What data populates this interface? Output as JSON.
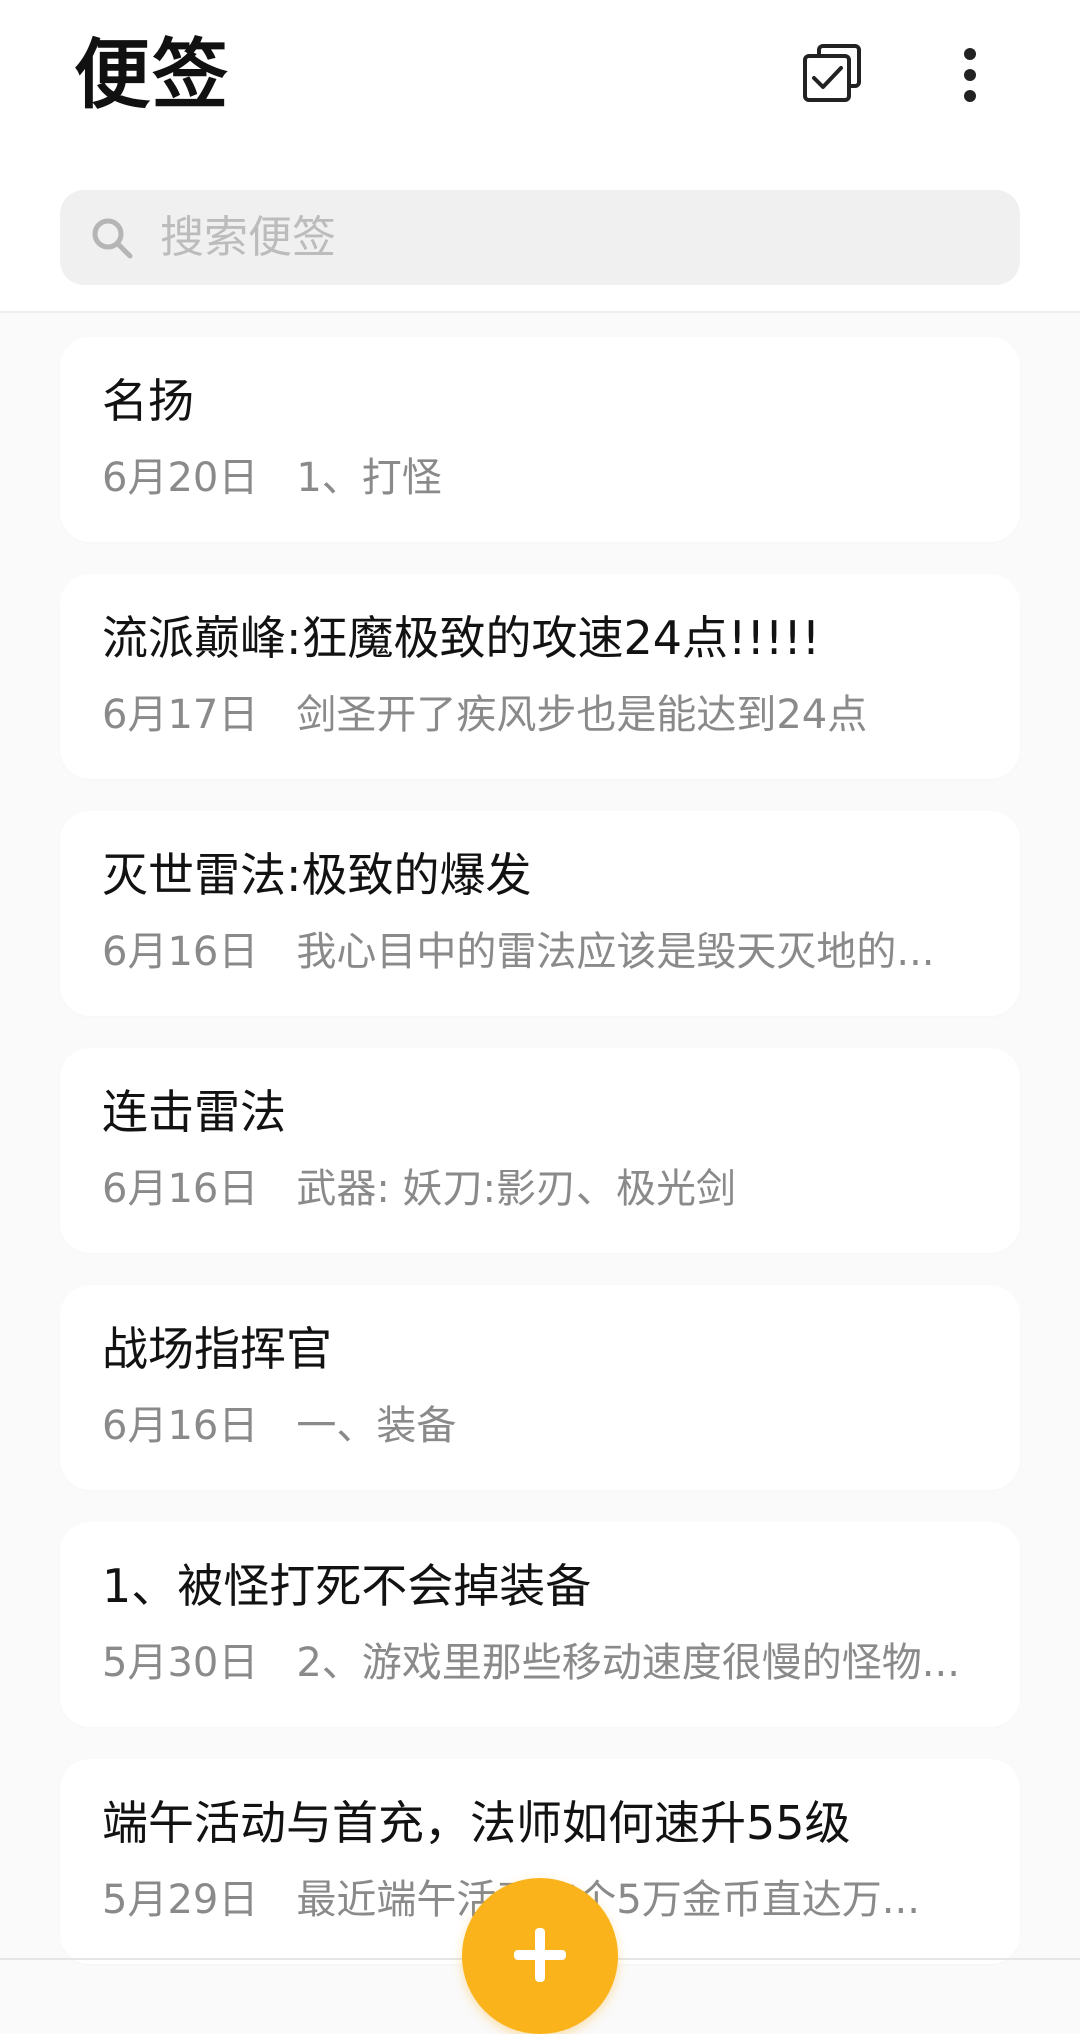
{
  "header": {
    "title": "便签",
    "select_icon": "checkbox-square-icon",
    "more_icon": "more-vertical-icon"
  },
  "search": {
    "placeholder": "搜索便签",
    "value": "",
    "icon": "search-icon"
  },
  "notes": [
    {
      "title": "名扬",
      "date": "6月20日",
      "preview": "1、打怪"
    },
    {
      "title": "流派巅峰:狂魔极致的攻速24点!!!!!",
      "date": "6月17日",
      "preview": "剑圣开了疾风步也是能达到24点"
    },
    {
      "title": "灭世雷法:极致的爆发",
      "date": "6月16日",
      "preview": "我心目中的雷法应该是毁天灭地的..."
    },
    {
      "title": "连击雷法",
      "date": "6月16日",
      "preview": "武器: 妖刀:影刃、极光剑"
    },
    {
      "title": "战场指挥官",
      "date": "6月16日",
      "preview": "一、装备"
    },
    {
      "title": "1、被怪打死不会掉装备",
      "date": "5月30日",
      "preview": "2、游戏里那些移动速度很慢的怪物..."
    },
    {
      "title": "端午活动与首充，法师如何速升55级",
      "date": "5月29日",
      "preview": "最近端午活动有个5万金币直达万..."
    }
  ],
  "fab": {
    "icon": "plus-icon",
    "color": "#fbb31b"
  },
  "colors": {
    "accent": "#fbb31b",
    "background": "#fafafa",
    "card": "#ffffff",
    "meta_text": "#8a8a8a"
  }
}
